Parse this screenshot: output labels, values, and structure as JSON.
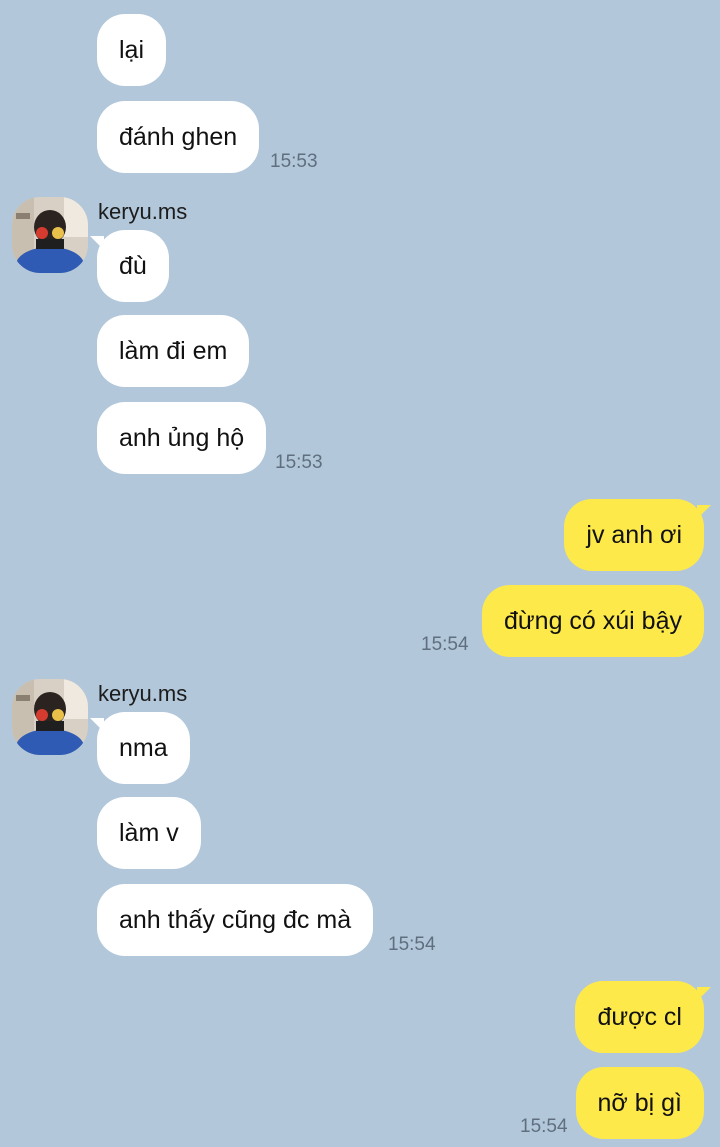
{
  "colors": {
    "background": "#b2c7da",
    "incoming_bubble": "#ffffff",
    "outgoing_bubble": "#fee94a",
    "timestamp": "#5f6f7f"
  },
  "messages": [
    {
      "direction": "incoming",
      "text": "lại"
    },
    {
      "direction": "incoming",
      "text": "đánh ghen",
      "time": "15:53"
    },
    {
      "direction": "incoming",
      "sender": "keryu.ms",
      "avatar": "profile-photo",
      "text": "đù"
    },
    {
      "direction": "incoming",
      "text": "làm đi em"
    },
    {
      "direction": "incoming",
      "text": "anh ủng hộ",
      "time": "15:53"
    },
    {
      "direction": "outgoing",
      "text": "jv anh ơi"
    },
    {
      "direction": "outgoing",
      "text": "đừng có xúi bậy",
      "time": "15:54"
    },
    {
      "direction": "incoming",
      "sender": "keryu.ms",
      "avatar": "profile-photo",
      "text": "nma"
    },
    {
      "direction": "incoming",
      "text": "làm v"
    },
    {
      "direction": "incoming",
      "text": "anh thấy cũng đc mà",
      "time": "15:54"
    },
    {
      "direction": "outgoing",
      "text": "được cl"
    },
    {
      "direction": "outgoing",
      "text": "nỡ bị gì",
      "time": "15:54"
    }
  ]
}
